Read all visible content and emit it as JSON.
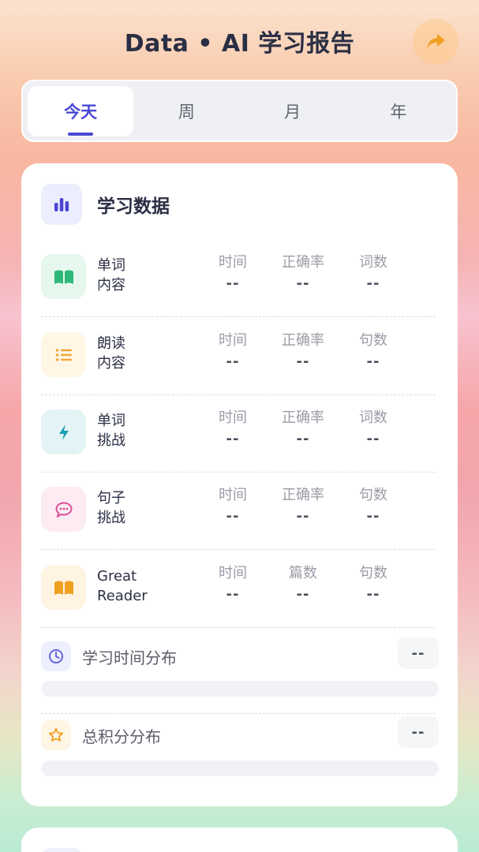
{
  "header": {
    "title": "Data • AI 学习报告",
    "share_icon": "share-arrow-icon"
  },
  "tabs": [
    {
      "label": "今天",
      "active": true
    },
    {
      "label": "周",
      "active": false
    },
    {
      "label": "月",
      "active": false
    },
    {
      "label": "年",
      "active": false
    }
  ],
  "study_data": {
    "title": "学习数据",
    "icon": "bar-chart-icon",
    "rows": [
      {
        "name_line1": "单词",
        "name_line2": "内容",
        "icon": "open-book-icon",
        "icon_color": "#2eb878",
        "icon_bg": "#e6f8ee",
        "stats": [
          {
            "label": "时间",
            "value": "--"
          },
          {
            "label": "正确率",
            "value": "--"
          },
          {
            "label": "词数",
            "value": "--"
          }
        ]
      },
      {
        "name_line1": "朗读",
        "name_line2": "内容",
        "icon": "list-icon",
        "icon_color": "#f0a63a",
        "icon_bg": "#fff6e6",
        "stats": [
          {
            "label": "时间",
            "value": "--"
          },
          {
            "label": "正确率",
            "value": "--"
          },
          {
            "label": "句数",
            "value": "--"
          }
        ]
      },
      {
        "name_line1": "单词",
        "name_line2": "挑战",
        "icon": "lightning-icon",
        "icon_color": "#1b9fb0",
        "icon_bg": "#e4f4f6",
        "stats": [
          {
            "label": "时间",
            "value": "--"
          },
          {
            "label": "正确率",
            "value": "--"
          },
          {
            "label": "词数",
            "value": "--"
          }
        ]
      },
      {
        "name_line1": "句子",
        "name_line2": "挑战",
        "icon": "chat-bubble-icon",
        "icon_color": "#d9509a",
        "icon_bg": "#fdebf3",
        "stats": [
          {
            "label": "时间",
            "value": "--"
          },
          {
            "label": "正确率",
            "value": "--"
          },
          {
            "label": "句数",
            "value": "--"
          }
        ]
      },
      {
        "name_line1": "Great",
        "name_line2": "Reader",
        "icon": "open-book-icon",
        "icon_color": "#f0a020",
        "icon_bg": "#fff4e2",
        "stats": [
          {
            "label": "时间",
            "value": "--"
          },
          {
            "label": "篇数",
            "value": "--"
          },
          {
            "label": "句数",
            "value": "--"
          }
        ]
      }
    ]
  },
  "distributions": [
    {
      "label": "学习时间分布",
      "value": "--",
      "icon": "clock-icon",
      "icon_color": "#6166d8",
      "icon_bg": "#eeeffc"
    },
    {
      "label": "总积分分布",
      "value": "--",
      "icon": "star-icon",
      "icon_color": "#f0a020",
      "icon_bg": "#fff5e4"
    }
  ],
  "colors": {
    "accent": "#4a47d4",
    "title": "#2b2f45"
  }
}
